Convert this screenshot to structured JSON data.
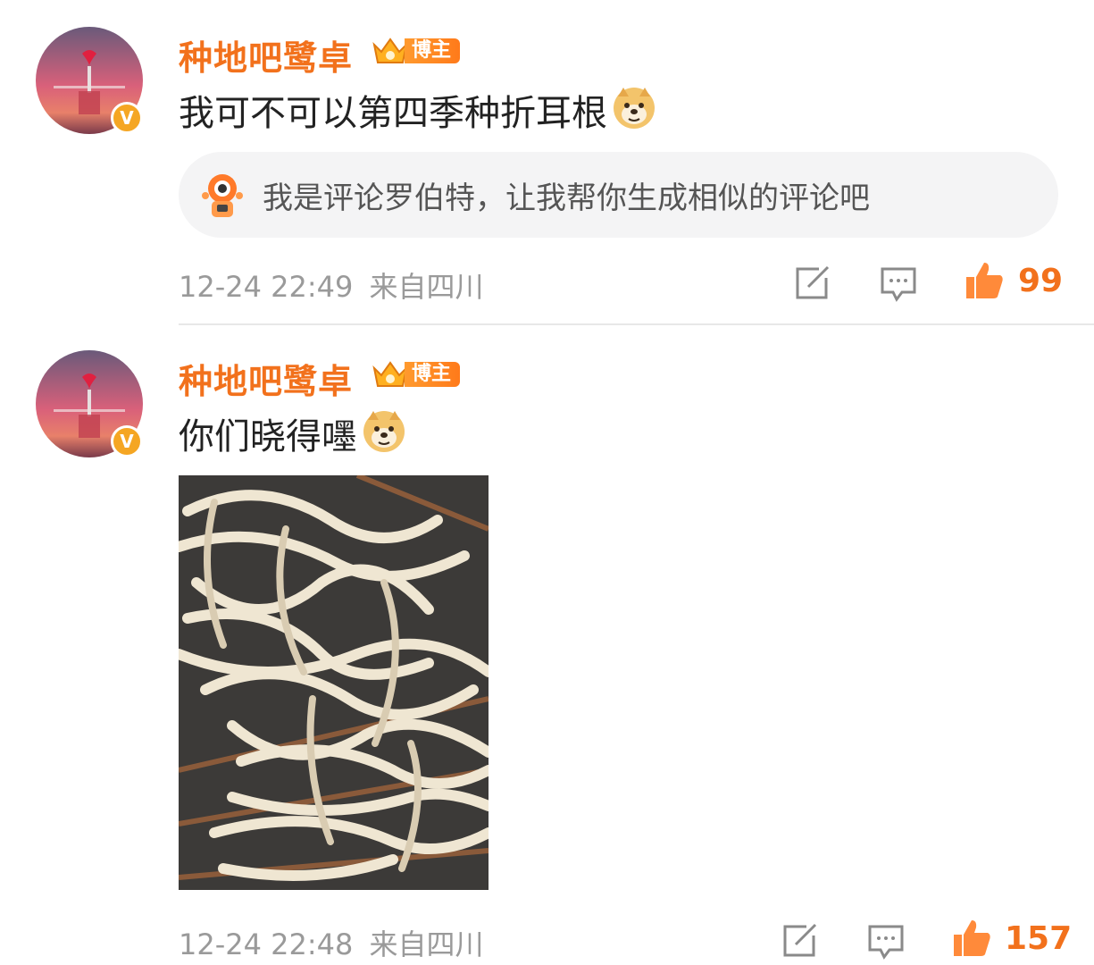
{
  "comments": [
    {
      "username": "种地吧鹭卓",
      "badge_label": "博主",
      "verified_icon": "v-verified-icon",
      "text": "我可不可以第四季种折耳根",
      "emoji": "doge-emoji",
      "ai_prompt": "我是评论罗伯特，让我帮你生成相似的评论吧",
      "time": "12-24 22:49",
      "location": "来自四川",
      "likes": "99"
    },
    {
      "username": "种地吧鹭卓",
      "badge_label": "博主",
      "verified_icon": "v-verified-icon",
      "text": "你们晓得嚜",
      "emoji": "doge-emoji",
      "image": "photo of bundled white roots",
      "time": "12-24 22:48",
      "location": "来自四川",
      "likes": "157"
    }
  ],
  "colors": {
    "accent": "#f2711c",
    "meta_gray": "#9a9a9a",
    "ai_bar_bg": "#f4f4f5"
  }
}
